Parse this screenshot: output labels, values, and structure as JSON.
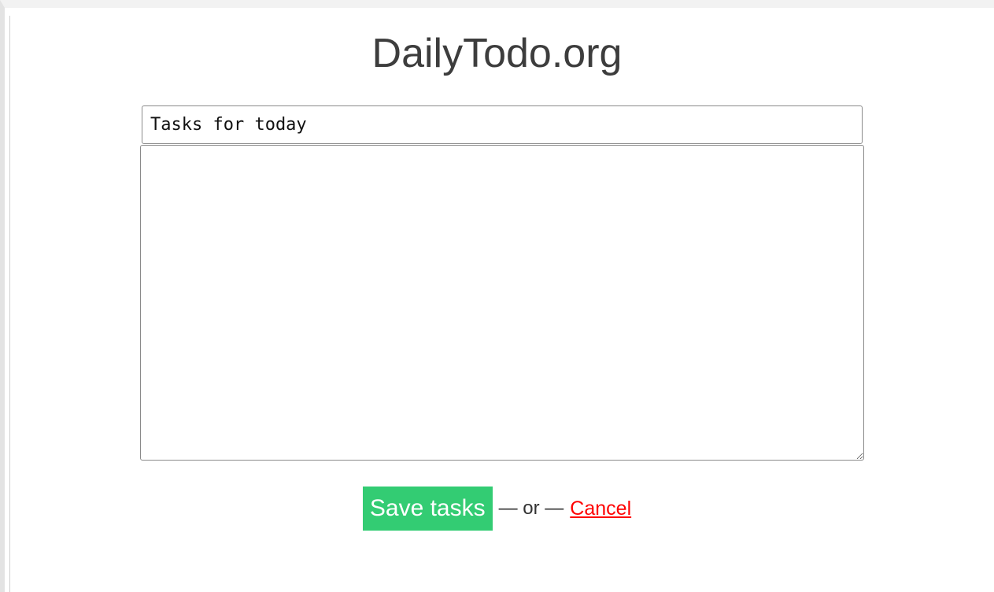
{
  "header": {
    "title": "DailyTodo.org"
  },
  "form": {
    "title_input_value": "Tasks for today",
    "tasks_value": ""
  },
  "actions": {
    "save_label": "Save tasks",
    "separator": "— or —",
    "cancel_label": "Cancel"
  },
  "colors": {
    "save_button_bg": "#33cc73",
    "cancel_link": "#ff0000",
    "title_text": "#3d3d3d"
  }
}
